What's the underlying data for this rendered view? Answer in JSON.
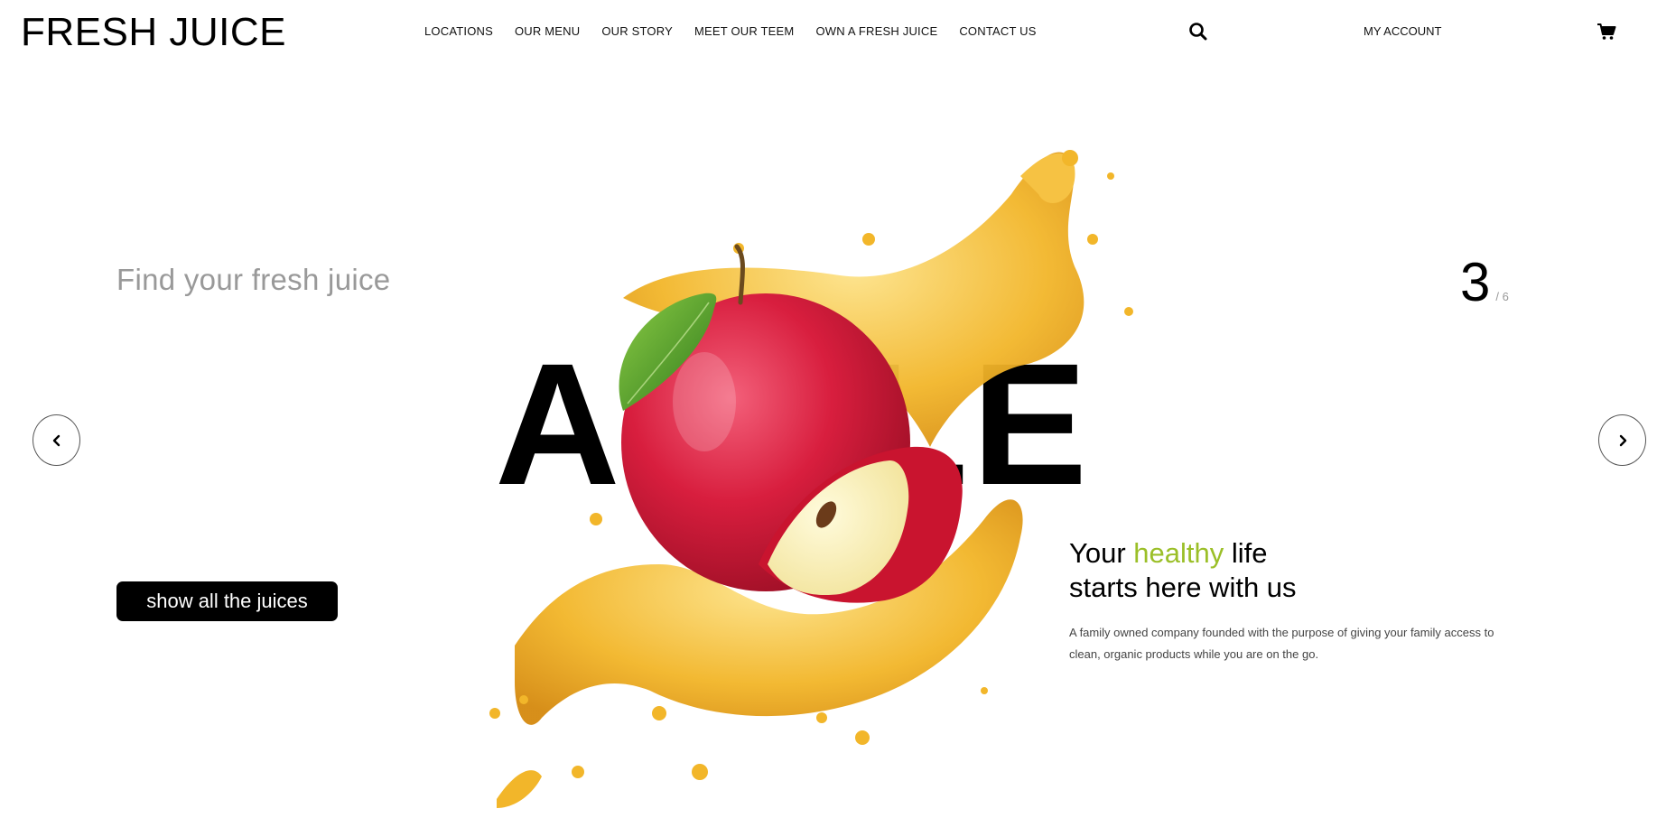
{
  "header": {
    "logo": "FRESH JUICE",
    "nav": [
      "LOCATIONS",
      "OUR MENU",
      "OUR STORY",
      "MEET OUR TEEM",
      "OWN A FRESH JUICE",
      "CONTACT US"
    ],
    "search_icon": "search-icon",
    "account_label": "MY ACCOUNT",
    "cart_icon": "cart-icon"
  },
  "hero": {
    "find_text": "Find your fresh juice",
    "counter_current": "3",
    "counter_total": "/ 6",
    "big_word": "APPLE",
    "cta_label": "show all the juices",
    "prev_icon": "chevron-left-icon",
    "next_icon": "chevron-right-icon",
    "tagline_pre": "Your ",
    "tagline_accent": "healthy",
    "tagline_post": " life",
    "tagline_line2": "starts here with us",
    "description": "A family owned company founded with the purpose of giving your family access to clean, organic products while you are on the go."
  },
  "colors": {
    "accent": "#9bbf28",
    "text": "#000000",
    "muted": "#999999",
    "juice": "#f2b62a",
    "apple_red": "#d81e3e"
  }
}
